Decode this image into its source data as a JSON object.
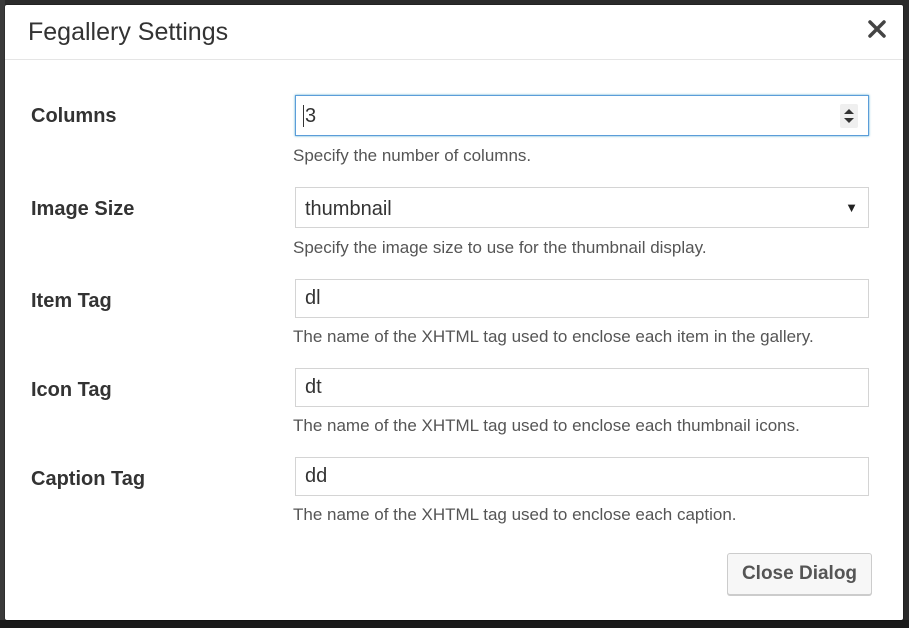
{
  "dialog": {
    "title": "Fegallery Settings",
    "close_button_label": "Close Dialog"
  },
  "fields": [
    {
      "label": "Columns",
      "value": "3",
      "type": "number",
      "description": "Specify the number of columns."
    },
    {
      "label": "Image Size",
      "value": "thumbnail",
      "type": "select",
      "description": "Specify the image size to use for the thumbnail display."
    },
    {
      "label": "Item Tag",
      "value": "dl",
      "type": "text",
      "description": "The name of the XHTML tag used to enclose each item in the gallery."
    },
    {
      "label": "Icon Tag",
      "value": "dt",
      "type": "text",
      "description": "The name of the XHTML tag used to enclose each thumbnail icons."
    },
    {
      "label": "Caption Tag",
      "value": "dd",
      "type": "text",
      "description": "The name of the XHTML tag used to enclose each caption."
    }
  ],
  "colors": {
    "focus_border": "#5b9dd9",
    "text": "#333333",
    "description": "#555555"
  }
}
